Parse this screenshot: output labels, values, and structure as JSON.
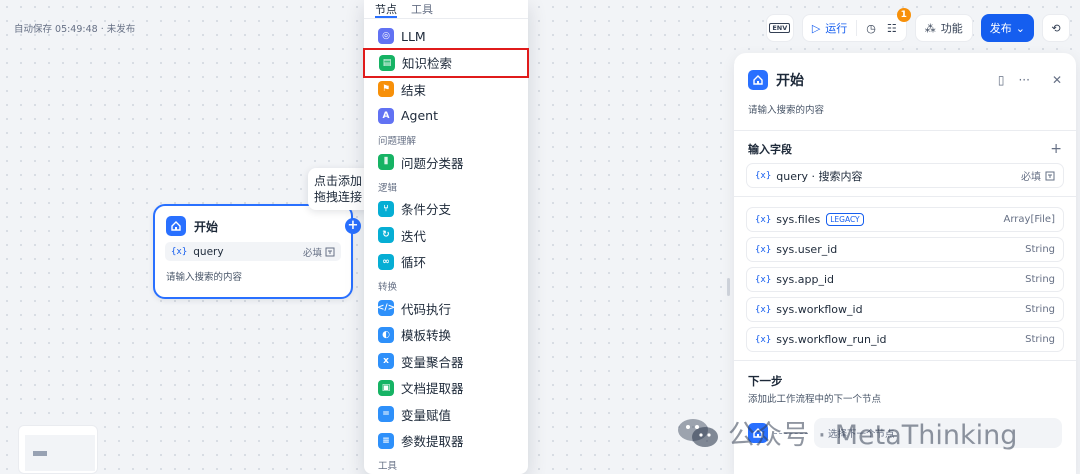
{
  "status": {
    "autosave": "自动保存 05:49:48 · 未发布"
  },
  "node": {
    "title": "开始",
    "var_icon": "{x}",
    "var_name": "query",
    "required": "必填",
    "desc": "请输入搜索的内容"
  },
  "tooltip": {
    "line1": "点击添加",
    "line2": "拖拽连接"
  },
  "menu": {
    "tabs": [
      "节点",
      "工具"
    ],
    "items": [
      {
        "label": "LLM",
        "color": "#6172f3",
        "icon": "llm-icon"
      },
      {
        "label": "知识检索",
        "color": "#16b364",
        "icon": "knowledge-retrieval-icon"
      },
      {
        "label": "结束",
        "color": "#f79009",
        "icon": "end-icon"
      },
      {
        "label": "Agent",
        "color": "#6172f3",
        "icon": "agent-icon"
      }
    ],
    "group_qc": "问题理解",
    "qc_item": {
      "label": "问题分类器",
      "color": "#16b364",
      "icon": "question-classifier-icon"
    },
    "group_logic": "逻辑",
    "logic_items": [
      {
        "label": "条件分支",
        "color": "#06aed4",
        "icon": "if-else-icon"
      },
      {
        "label": "迭代",
        "color": "#06aed4",
        "icon": "iteration-icon"
      },
      {
        "label": "循环",
        "color": "#06aed4",
        "icon": "loop-icon"
      }
    ],
    "group_transform": "转换",
    "transform_items": [
      {
        "label": "代码执行",
        "color": "#2e90fa",
        "icon": "code-icon"
      },
      {
        "label": "模板转换",
        "color": "#2e90fa",
        "icon": "template-icon"
      },
      {
        "label": "变量聚合器",
        "color": "#2e90fa",
        "icon": "variable-aggregator-icon"
      },
      {
        "label": "文档提取器",
        "color": "#16b364",
        "icon": "doc-extractor-icon"
      },
      {
        "label": "变量赋值",
        "color": "#2e90fa",
        "icon": "assigner-icon"
      },
      {
        "label": "参数提取器",
        "color": "#2e90fa",
        "icon": "parameter-extractor-icon"
      }
    ],
    "group_tools": "工具"
  },
  "toolbar": {
    "env": "ENV",
    "run": "运行",
    "badge": "1",
    "features": "功能",
    "publish": "发布"
  },
  "panel": {
    "title": "开始",
    "desc": "请输入搜索的内容",
    "input_label": "输入字段",
    "field": {
      "name": "query · 搜索内容",
      "required": "必填"
    },
    "sys_vars": [
      {
        "name": "sys.files",
        "tag": "LEGACY",
        "type": "Array[File]"
      },
      {
        "name": "sys.user_id",
        "type": "String"
      },
      {
        "name": "sys.app_id",
        "type": "String"
      },
      {
        "name": "sys.workflow_id",
        "type": "String"
      },
      {
        "name": "sys.workflow_run_id",
        "type": "String"
      }
    ],
    "next_title": "下一步",
    "next_desc": "添加此工作流程中的下一个节点",
    "next_placeholder": "选择下一个节点"
  },
  "watermark": "公众号 · MetaThinking"
}
